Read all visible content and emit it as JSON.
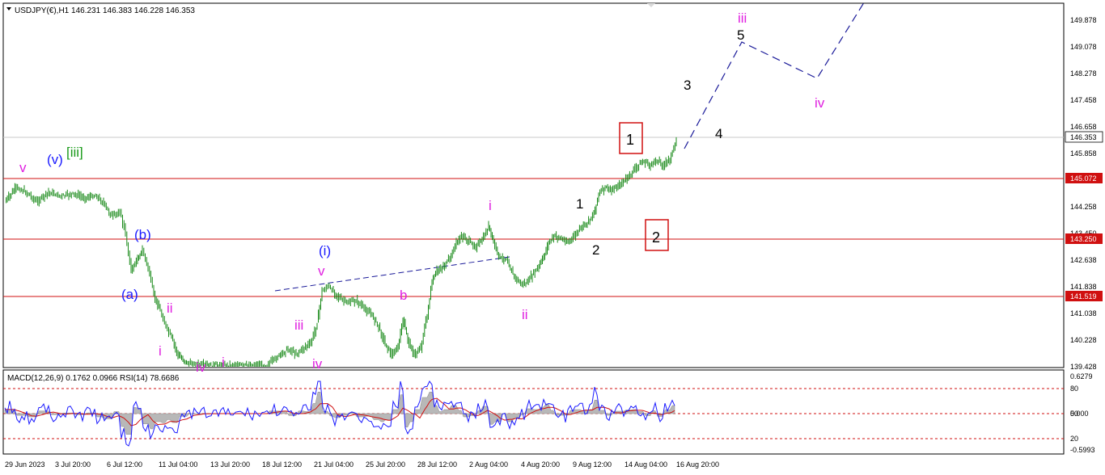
{
  "header": {
    "symbol_line": "USDJPY(€),H1  146.231 146.383 146.228 146.353"
  },
  "indicator_header": {
    "text": "MACD(12,26,9) 0.1762 0.0966  RSI(14) 78.6686"
  },
  "price_axis": {
    "ticks": [
      "149.878",
      "149.078",
      "148.278",
      "147.458",
      "146.658",
      "145.858",
      "144.258",
      "143.450",
      "142.638",
      "141.838",
      "141.038",
      "140.228",
      "139.428"
    ],
    "current_price": "146.353",
    "levels": [
      "145.072",
      "143.250",
      "141.519"
    ]
  },
  "indicator_axis": {
    "ticks": [
      "0.6279",
      "80",
      "50",
      "0.000",
      "20",
      "-0.5993"
    ]
  },
  "time_axis": {
    "ticks": [
      "29 Jun 2023",
      "3 Jul 20:00",
      "6 Jul 12:00",
      "11 Jul 04:00",
      "13 Jul 20:00",
      "18 Jul 12:00",
      "21 Jul 04:00",
      "25 Jul 20:00",
      "28 Jul 12:00",
      "2 Aug 04:00",
      "4 Aug 20:00",
      "9 Aug 12:00",
      "14 Aug 04:00",
      "16 Aug 20:00"
    ]
  },
  "wave_labels": [
    {
      "text": "v",
      "color": "#e020e0"
    },
    {
      "text": "(v)",
      "color": "#1a1aff"
    },
    {
      "text": "[iii]",
      "color": "#1a9a1a"
    },
    {
      "text": "(b)",
      "color": "#1a1aff"
    },
    {
      "text": "(a)",
      "color": "#1a1aff"
    },
    {
      "text": "ii",
      "color": "#e020e0"
    },
    {
      "text": "i",
      "color": "#e020e0"
    },
    {
      "text": "iv",
      "color": "#e020e0"
    },
    {
      "text": "i",
      "color": "#e020e0"
    },
    {
      "text": "(i)",
      "color": "#1a1aff"
    },
    {
      "text": "v",
      "color": "#e020e0"
    },
    {
      "text": "iii",
      "color": "#e020e0"
    },
    {
      "text": "iv",
      "color": "#e020e0"
    },
    {
      "text": "b",
      "color": "#e020e0"
    },
    {
      "text": "i",
      "color": "#e020e0"
    },
    {
      "text": "ii",
      "color": "#e020e0"
    },
    {
      "text": "1",
      "color": "#000000"
    },
    {
      "text": "2",
      "color": "#000000"
    },
    {
      "text": "1",
      "color": "#000000"
    },
    {
      "text": "2",
      "color": "#000000"
    },
    {
      "text": "3",
      "color": "#000000"
    },
    {
      "text": "4",
      "color": "#000000"
    },
    {
      "text": "5",
      "color": "#000000"
    },
    {
      "text": "iii",
      "color": "#e020e0"
    },
    {
      "text": "iv",
      "color": "#e020e0"
    }
  ],
  "colors": {
    "candles": "#1a8a1a",
    "levels": "#d01010",
    "projection": "#1a1a99",
    "macd_hist": "#b0b0b0",
    "macd_signal": "#d01010",
    "rsi": "#1a1aff"
  }
}
